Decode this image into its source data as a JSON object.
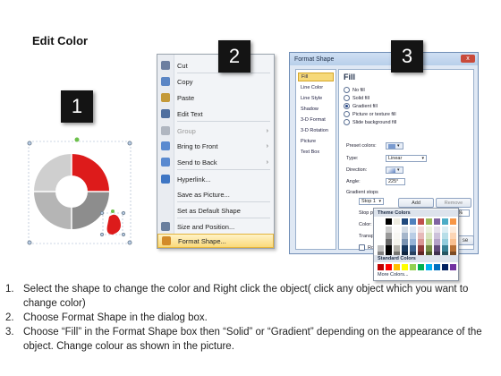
{
  "title": "Edit Color",
  "steps_badges": [
    "1",
    "2",
    "3"
  ],
  "context_menu": {
    "items": [
      {
        "label": "Cut",
        "icon": "scissors-icon",
        "disabled": false,
        "submenu": false,
        "highlight": false
      },
      {
        "label": "Copy",
        "icon": "copy-icon",
        "disabled": false,
        "submenu": false,
        "highlight": false
      },
      {
        "label": "Paste",
        "icon": "paste-icon",
        "disabled": false,
        "submenu": false,
        "highlight": false
      },
      {
        "label": "Edit Text",
        "icon": "edit-text-icon",
        "disabled": false,
        "submenu": false,
        "highlight": false
      },
      {
        "label": "Group",
        "icon": "group-icon",
        "disabled": true,
        "submenu": true,
        "highlight": false
      },
      {
        "label": "Bring to Front",
        "icon": "bring-front-icon",
        "disabled": false,
        "submenu": true,
        "highlight": false
      },
      {
        "label": "Send to Back",
        "icon": "send-back-icon",
        "disabled": false,
        "submenu": true,
        "highlight": false
      },
      {
        "label": "Hyperlink...",
        "icon": "hyperlink-icon",
        "disabled": false,
        "submenu": false,
        "highlight": false
      },
      {
        "label": "Save as Picture...",
        "icon": "",
        "disabled": false,
        "submenu": false,
        "highlight": false
      },
      {
        "label": "Set as Default Shape",
        "icon": "",
        "disabled": false,
        "submenu": false,
        "highlight": false
      },
      {
        "label": "Size and Position...",
        "icon": "size-position-icon",
        "disabled": false,
        "submenu": false,
        "highlight": false
      },
      {
        "label": "Format Shape...",
        "icon": "format-shape-icon",
        "disabled": false,
        "submenu": false,
        "highlight": true
      }
    ]
  },
  "dialog": {
    "title": "Format Shape",
    "close_label": "x",
    "nav": [
      "Fill",
      "Line Color",
      "Line Style",
      "Shadow",
      "3-D Format",
      "3-D Rotation",
      "Picture",
      "Text Box"
    ],
    "section_title": "Fill",
    "fill_options": [
      {
        "label": "No fill",
        "selected": false
      },
      {
        "label": "Solid fill",
        "selected": false
      },
      {
        "label": "Gradient fill",
        "selected": true
      },
      {
        "label": "Picture or texture fill",
        "selected": false
      },
      {
        "label": "Slide background fill",
        "selected": false
      }
    ],
    "preset_colors_label": "Preset colors:",
    "type_label": "Type:",
    "type_value": "Linear",
    "direction_label": "Direction:",
    "angle_label": "Angle:",
    "angle_value": "225°",
    "gradient_stops_label": "Gradient stops",
    "stop_value": "Stop 1",
    "add_label": "Add",
    "remove_label": "Remove",
    "stop_position_label": "Stop position:",
    "stop_position_value": "35%",
    "color_label": "Color:",
    "transparency_label": "Transpa",
    "rotate_label": "Rotate",
    "close_button": "se"
  },
  "palette": {
    "theme_label": "Theme Colors",
    "standard_label": "Standard Colors",
    "more_label": "More Colors...",
    "theme_top": [
      "#ffffff",
      "#000000",
      "#eeece1",
      "#1f497d",
      "#4f81bd",
      "#c0504d",
      "#9bbb59",
      "#8064a2",
      "#4bacc6",
      "#f79646"
    ],
    "standard": [
      "#c00000",
      "#ff0000",
      "#ffc000",
      "#ffff00",
      "#92d050",
      "#00b050",
      "#00b0f0",
      "#0070c0",
      "#002060",
      "#7030a0"
    ]
  },
  "instructions": [
    {
      "n": "1.",
      "text": "Select the shape to change the color and Right click the object( click any object which you want to change color)"
    },
    {
      "n": "2.",
      "text": "Choose Format Shape in the dialog box."
    },
    {
      "n": "3.",
      "text": "Choose “Fill” in the Format Shape box then “Solid” or “Gradient” depending on the appearance of the object. Change colour as shown in the picture."
    }
  ]
}
